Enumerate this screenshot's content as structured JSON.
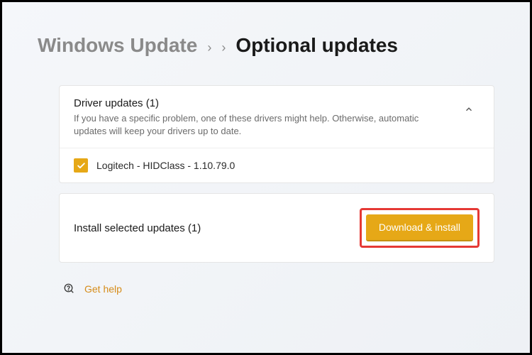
{
  "breadcrumb": {
    "parent": "Windows Update",
    "current": "Optional updates"
  },
  "driver_section": {
    "title": "Driver updates (1)",
    "description": "If you have a specific problem, one of these drivers might help. Otherwise, automatic updates will keep your drivers up to date.",
    "items": [
      {
        "name": "Logitech - HIDClass - 1.10.79.0",
        "checked": true
      }
    ]
  },
  "install_bar": {
    "label": "Install selected updates (1)",
    "button": "Download & install"
  },
  "help": {
    "label": "Get help"
  }
}
